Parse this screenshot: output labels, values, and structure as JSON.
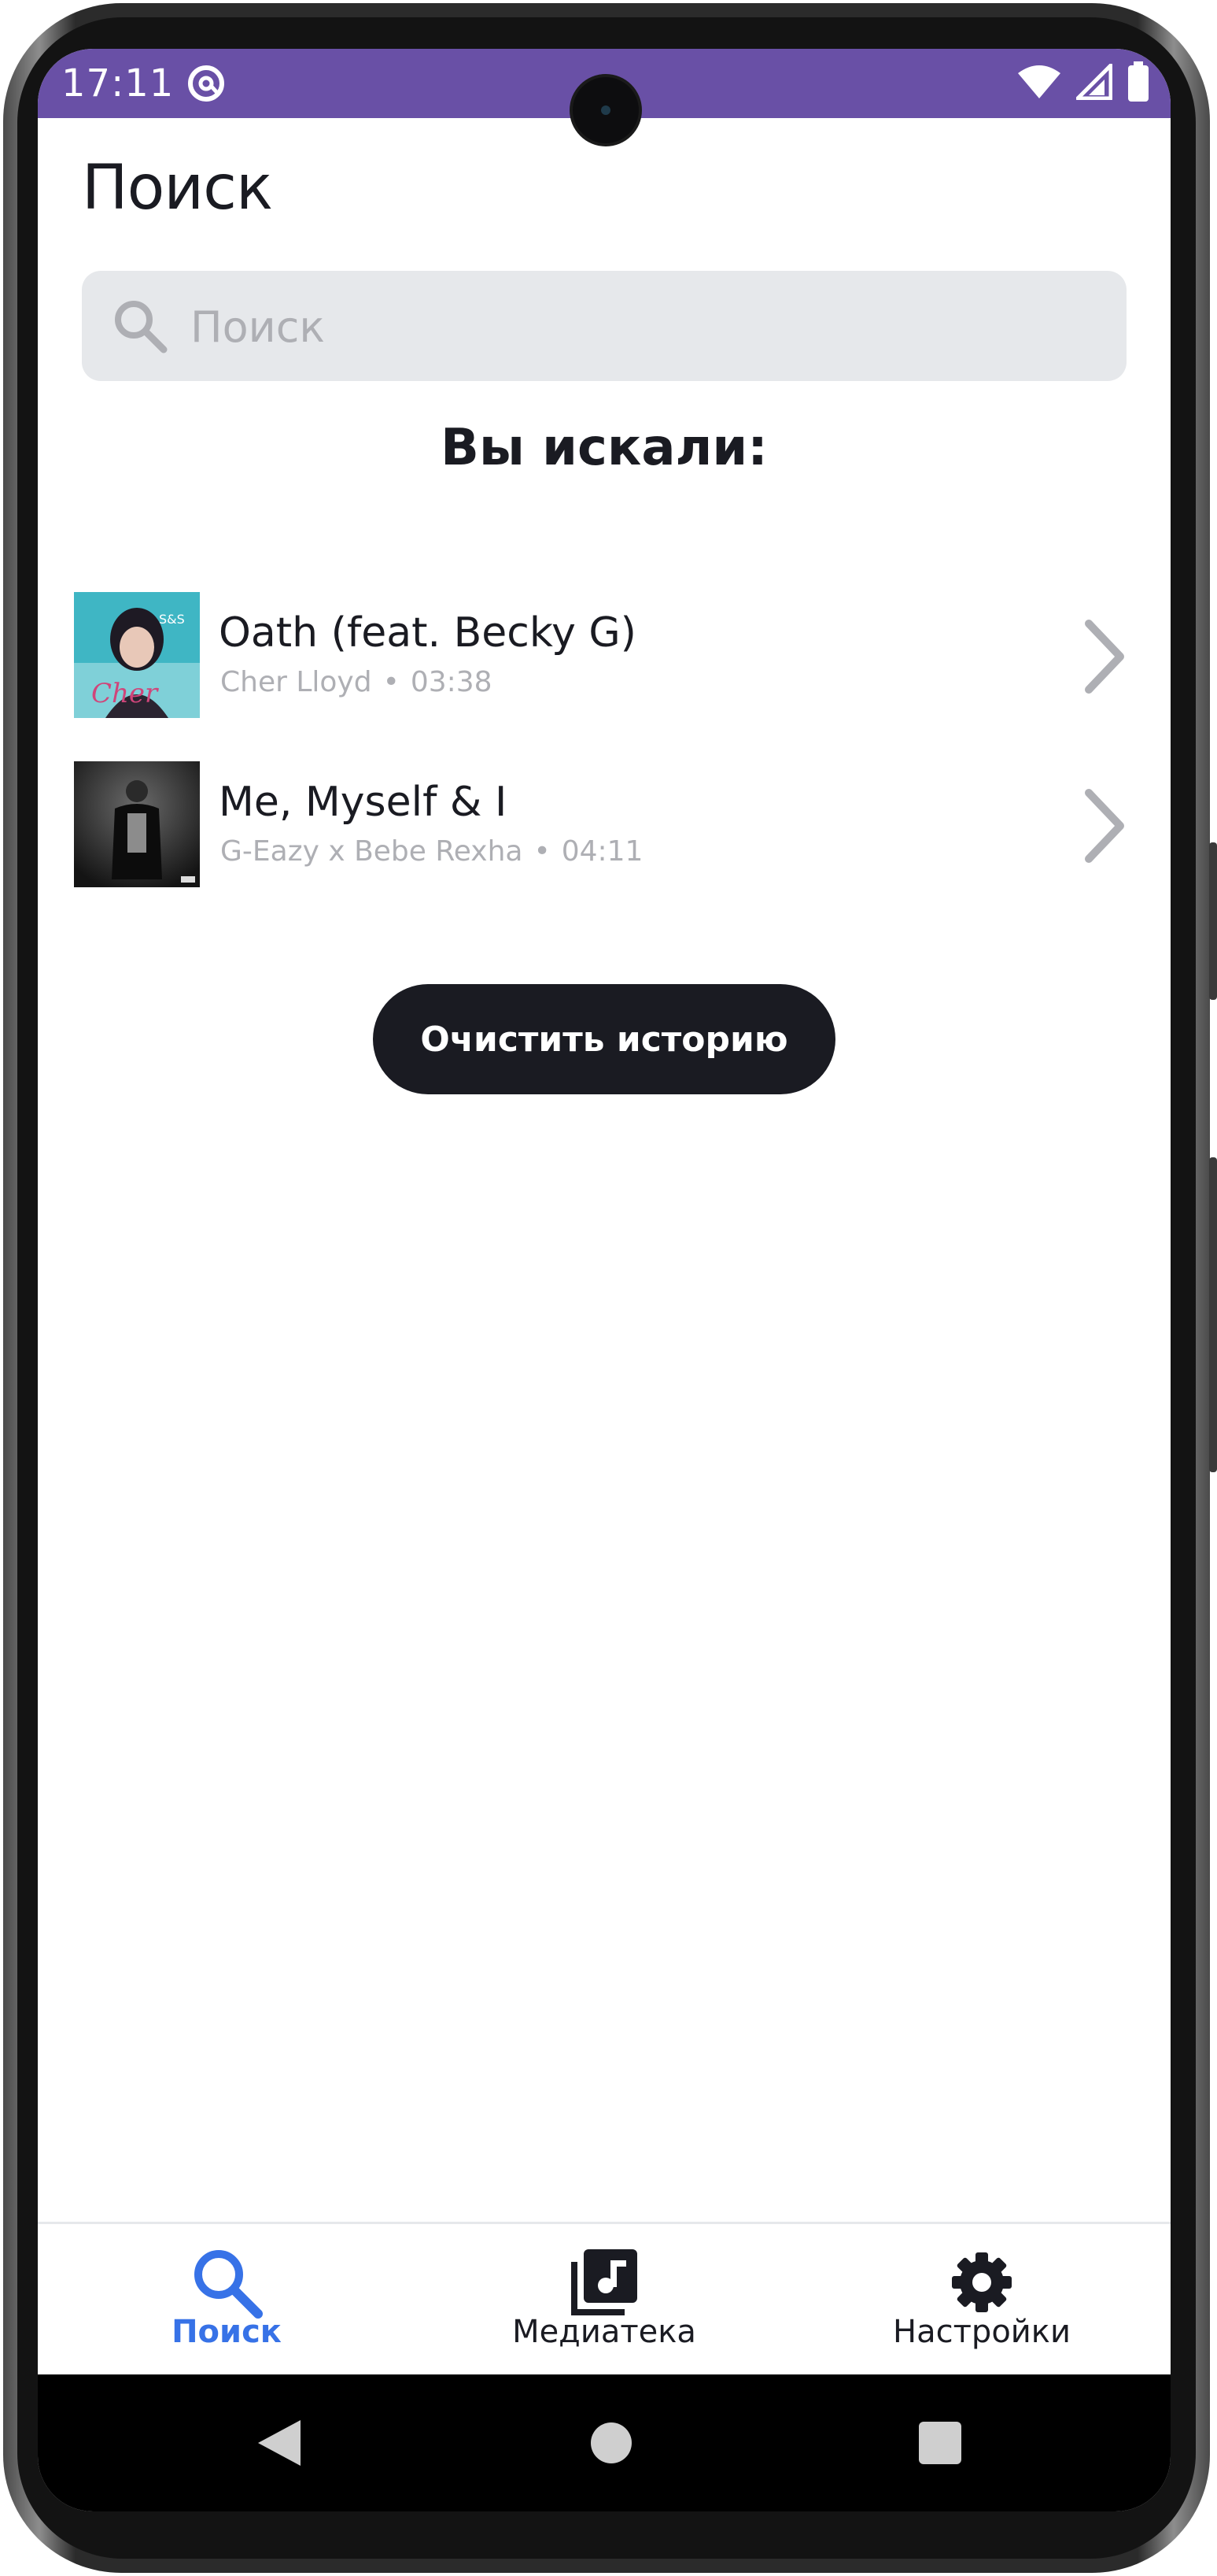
{
  "status_bar": {
    "time": "17:11",
    "app_icon": "at-sign-icon",
    "icons": [
      "wifi-icon",
      "signal-icon",
      "battery-icon"
    ],
    "color": "#6950a6"
  },
  "page": {
    "title": "Поиск"
  },
  "search": {
    "placeholder": "Поиск",
    "value": "",
    "icon": "search-icon"
  },
  "history": {
    "title": "Вы искали:",
    "tracks": [
      {
        "name": "Oath (feat. Becky G)",
        "artist": "Cher Lloyd",
        "duration": "03:38",
        "cover_colors": [
          "#3fb6c4",
          "#d0457a"
        ]
      },
      {
        "name": "Me, Myself & I",
        "artist": "G-Eazy x Bebe Rexha",
        "duration": "04:11",
        "cover_colors": [
          "#1a1a1a",
          "#707070"
        ]
      }
    ],
    "separator": "•"
  },
  "actions": {
    "clear_label": "Очистить историю"
  },
  "bottom_nav": {
    "items": [
      {
        "label": "Поиск",
        "icon": "search-icon",
        "active": true
      },
      {
        "label": "Медиатека",
        "icon": "library-music-icon",
        "active": false
      },
      {
        "label": "Настройки",
        "icon": "settings-gear-icon",
        "active": false
      }
    ],
    "active_color": "#3772e7"
  },
  "system_nav": {
    "buttons": [
      "back-icon",
      "home-icon",
      "recents-icon"
    ]
  }
}
